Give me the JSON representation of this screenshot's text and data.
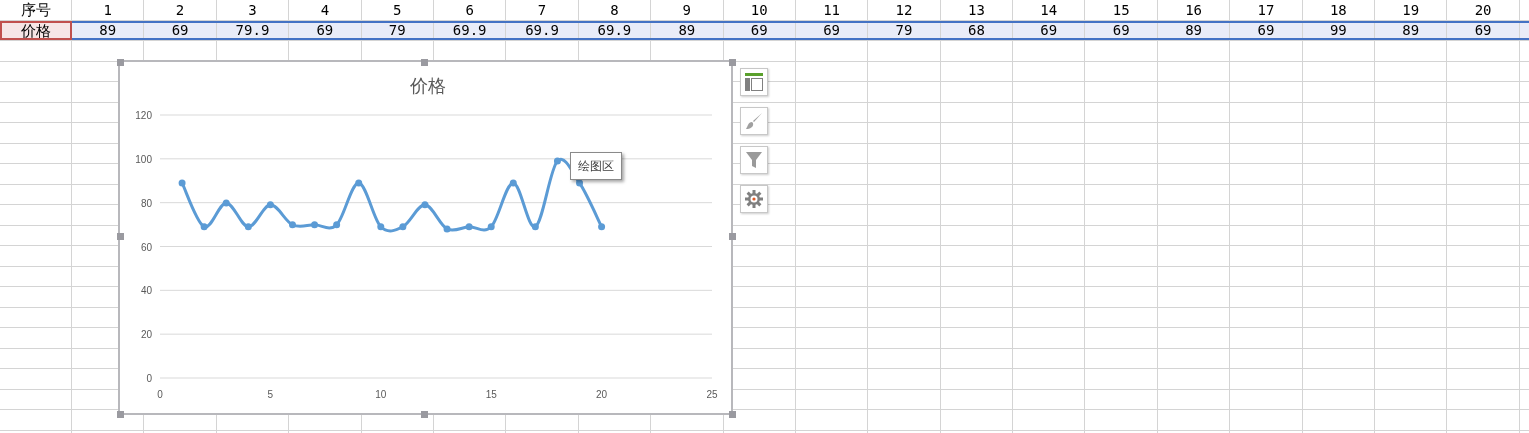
{
  "sheet": {
    "rows": [
      {
        "label": "序号",
        "selected": false,
        "cells": [
          "1",
          "2",
          "3",
          "4",
          "5",
          "6",
          "7",
          "8",
          "9",
          "10",
          "11",
          "12",
          "13",
          "14",
          "15",
          "16",
          "17",
          "18",
          "19",
          "20"
        ]
      },
      {
        "label": "价格",
        "selected": true,
        "cells": [
          "89",
          "69",
          "79.9",
          "69",
          "79",
          "69.9",
          "69.9",
          "69.9",
          "89",
          "69",
          "69",
          "79",
          "68",
          "69",
          "69",
          "89",
          "69",
          "99",
          "89",
          "69"
        ]
      }
    ]
  },
  "chart": {
    "tooltip": "绘图区",
    "chart_data": {
      "type": "line",
      "title": "价格",
      "x": [
        1,
        2,
        3,
        4,
        5,
        6,
        7,
        8,
        9,
        10,
        11,
        12,
        13,
        14,
        15,
        16,
        17,
        18,
        19,
        20
      ],
      "grid": true,
      "series": [
        {
          "color": "#5b9bd5",
          "marker": true,
          "values": [
            89,
            69,
            79.9,
            69,
            79,
            69.9,
            69.9,
            69.9,
            89,
            69,
            69,
            79,
            68,
            69,
            69,
            89,
            69,
            99,
            89,
            69
          ]
        }
      ],
      "xlim": [
        0,
        25
      ],
      "ylim": [
        0,
        120
      ],
      "xticks": [
        0,
        5,
        10,
        15,
        20,
        25
      ],
      "yticks": [
        0,
        20,
        40,
        60,
        80,
        100,
        120
      ]
    }
  },
  "side_buttons": [
    {
      "kind": "elements"
    },
    {
      "kind": "style"
    },
    {
      "kind": "filter"
    },
    {
      "kind": "settings"
    }
  ]
}
